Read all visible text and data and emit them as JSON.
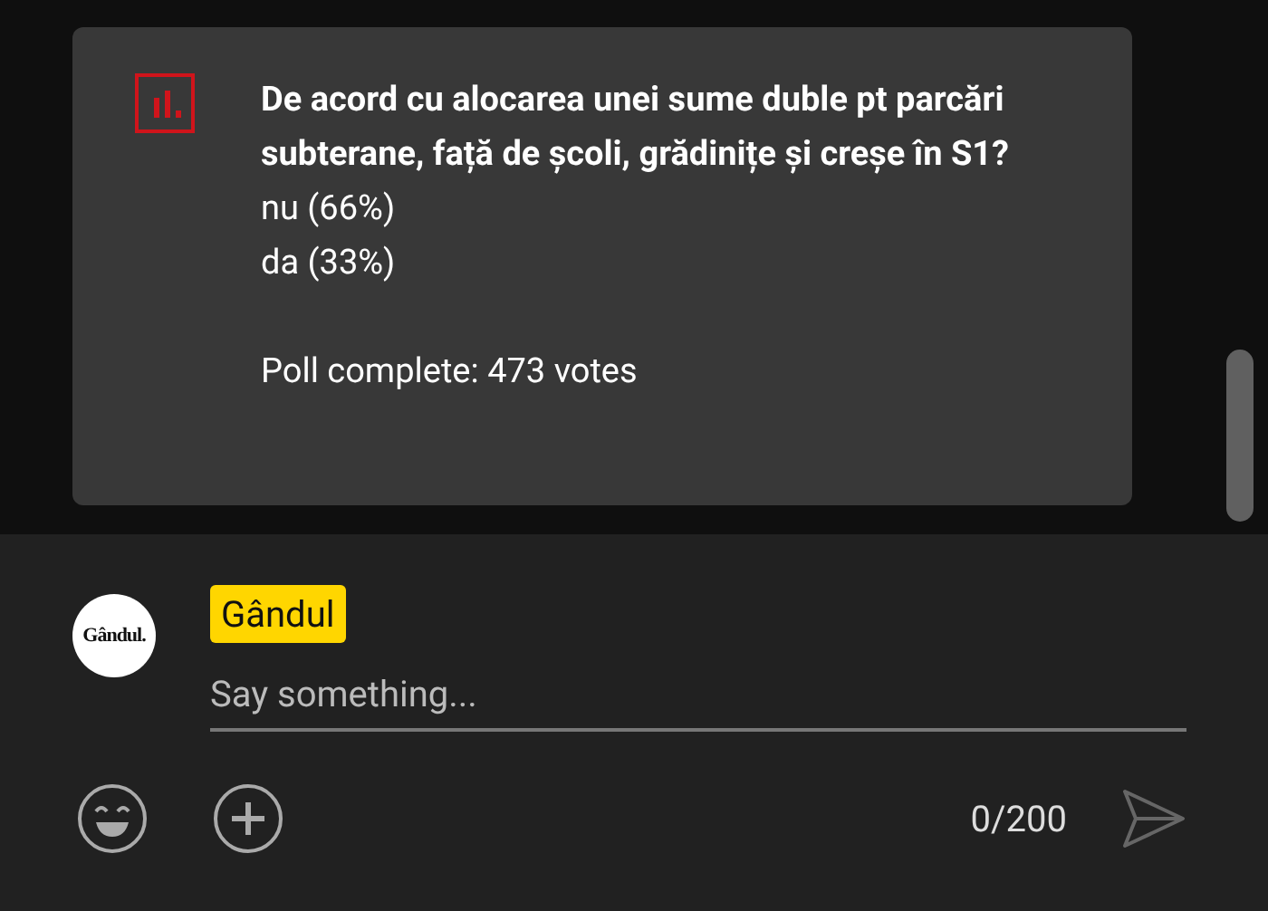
{
  "poll": {
    "question": "De acord cu alocarea unei sume duble pt parcări subterane, față de școli, grădinițe și creșe în S1?",
    "options": [
      "nu (66%)",
      "da (33%)"
    ],
    "status": "Poll complete: 473 votes"
  },
  "composer": {
    "avatar_text": "Gândul.",
    "author": "Gândul",
    "placeholder": "Say something...",
    "counter": "0/200"
  }
}
